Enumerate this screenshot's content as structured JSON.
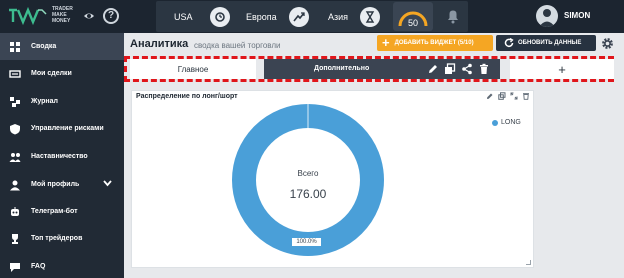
{
  "brand": {
    "name": "TRADER MAKE MONEY",
    "accent": "#3dbb8f"
  },
  "header": {
    "markets": [
      {
        "label": "USA",
        "icon": "timer-icon"
      },
      {
        "label": "Европа",
        "icon": "trend-icon"
      },
      {
        "label": "Азия",
        "icon": "hourglass-icon"
      }
    ],
    "gauge_value": "50",
    "username": "SIMON"
  },
  "sidebar": {
    "items": [
      {
        "label": "Сводка",
        "icon": "dashboard-icon",
        "active": true
      },
      {
        "label": "Мои сделки",
        "icon": "trades-icon"
      },
      {
        "label": "Журнал",
        "icon": "journal-icon"
      },
      {
        "label": "Управление рисками",
        "icon": "shield-icon"
      },
      {
        "label": "Наставничество",
        "icon": "mentoring-icon"
      },
      {
        "label": "Мой профиль",
        "icon": "profile-icon"
      },
      {
        "label": "Телеграм-бот",
        "icon": "bot-icon"
      },
      {
        "label": "Топ трейдеров",
        "icon": "trophy-icon"
      },
      {
        "label": "FAQ",
        "icon": "faq-icon"
      }
    ]
  },
  "page": {
    "title": "Аналитика",
    "subtitle": "сводка вашей торговли",
    "add_widget_label": "ДОБАВИТЬ ВИДЖЕТ (5/10)",
    "refresh_label": "ОБНОВИТЬ ДАННЫЕ"
  },
  "tabs": {
    "main_label": "Главное",
    "extra_label": "Дополнительно",
    "add_label": "+"
  },
  "widget": {
    "title": "Распределение по лонг/шорт",
    "legend_label": "LONG",
    "center_caption": "Всего",
    "center_value": "176.00",
    "percent_label": "100.0%"
  },
  "chart_data": {
    "type": "pie",
    "title": "Распределение по лонг/шорт",
    "categories": [
      "LONG"
    ],
    "values": [
      176
    ],
    "percents": [
      100.0
    ],
    "colors": [
      "#4a9fd8"
    ],
    "legend_position": "top-right"
  }
}
